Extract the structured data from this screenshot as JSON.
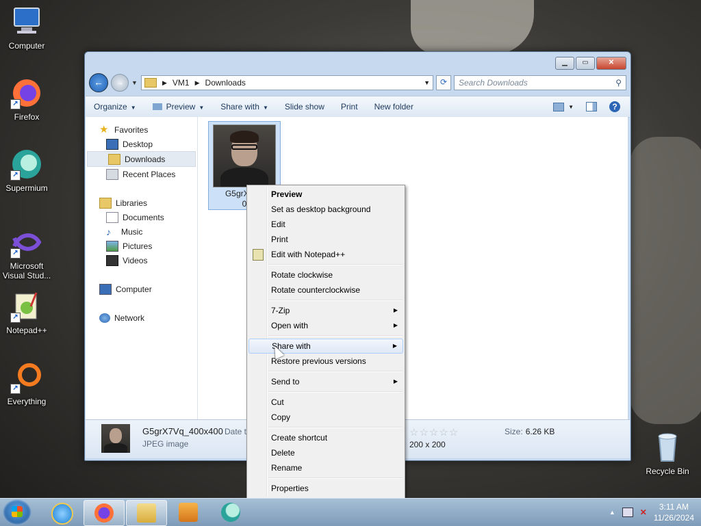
{
  "desktop": {
    "icons": [
      {
        "label": "Computer"
      },
      {
        "label": "Firefox"
      },
      {
        "label": "Supermium"
      },
      {
        "label": "Microsoft Visual Stud..."
      },
      {
        "label": "Notepad++"
      },
      {
        "label": "Everything"
      },
      {
        "label": "Recycle Bin"
      }
    ]
  },
  "window": {
    "breadcrumb": [
      "VM1",
      "Downloads"
    ],
    "search_placeholder": "Search Downloads",
    "toolbar": {
      "organize": "Organize",
      "preview": "Preview",
      "share_with": "Share with",
      "slide_show": "Slide show",
      "print": "Print",
      "new_folder": "New folder"
    },
    "nav": {
      "favorites": "Favorites",
      "desktop": "Desktop",
      "downloads": "Downloads",
      "recent_places": "Recent Places",
      "libraries": "Libraries",
      "documents": "Documents",
      "music": "Music",
      "pictures": "Pictures",
      "videos": "Videos",
      "computer": "Computer",
      "network": "Network"
    },
    "file": {
      "name_line1": "G5grX7Vq",
      "name_line2": "0"
    },
    "details": {
      "name": "G5grX7Vq_400x400",
      "type": "JPEG image",
      "date_label": "Date ta",
      "stars": "☆☆☆☆☆",
      "dimensions": "200 x 200",
      "size_label": "Size:",
      "size_value": "6.26 KB"
    }
  },
  "context_menu": {
    "preview": "Preview",
    "set_desktop_bg": "Set as desktop background",
    "edit": "Edit",
    "print": "Print",
    "edit_notepad": "Edit with Notepad++",
    "rotate_cw": "Rotate clockwise",
    "rotate_ccw": "Rotate counterclockwise",
    "zip": "7-Zip",
    "open_with": "Open with",
    "share_with": "Share with",
    "restore": "Restore previous versions",
    "send_to": "Send to",
    "cut": "Cut",
    "copy": "Copy",
    "create_shortcut": "Create shortcut",
    "delete": "Delete",
    "rename": "Rename",
    "properties": "Properties"
  },
  "taskbar": {
    "time": "3:11 AM",
    "date": "11/26/2024"
  },
  "colors": {
    "accent": "#1d5fb3",
    "menu_hover": "#aecff7"
  }
}
